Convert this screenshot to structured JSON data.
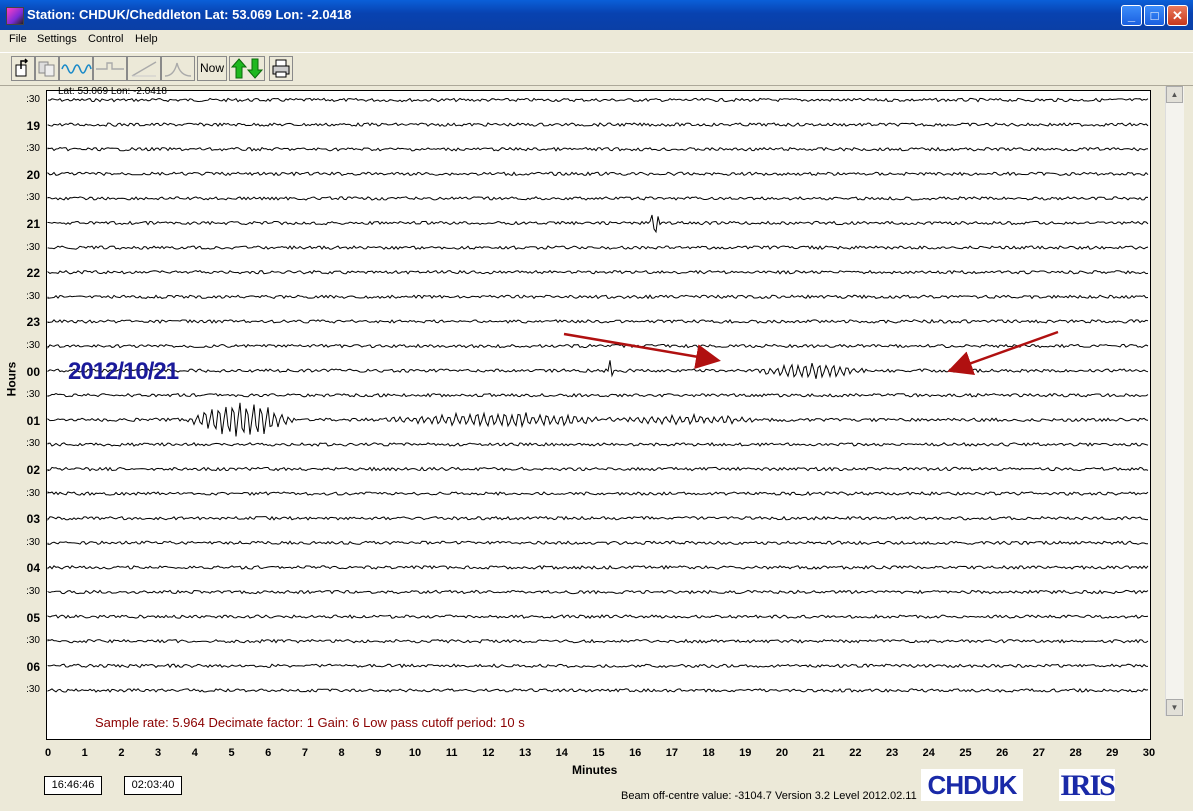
{
  "window": {
    "title": "Station: CHDUK/Cheddleton Lat: 53.069 Lon: -2.0418",
    "controls": {
      "minimize": "_",
      "maximize": "□",
      "close": "✕"
    }
  },
  "menu": [
    "File",
    "Settings",
    "Control",
    "Help"
  ],
  "toolbar": {
    "tools": [
      {
        "name": "open-icon"
      },
      {
        "name": "copy-icon"
      },
      {
        "name": "waveform-icon"
      },
      {
        "name": "filter-step-icon"
      },
      {
        "name": "ramp-icon"
      },
      {
        "name": "pulse-icon"
      }
    ],
    "now_label": "Now",
    "updown_icon": "green-up-down-arrows-icon",
    "print_icon": "printer-icon"
  },
  "plot": {
    "coordinates": "Lat: 53.069 Lon: -2.0418",
    "date": "2012/10/21",
    "y_axis_title": "Hours",
    "x_axis_title": "Minutes",
    "row_labels": [
      ":30",
      "19",
      ":30",
      "20",
      ":30",
      "21",
      ":30",
      "22",
      ":30",
      "23",
      ":30",
      "00",
      ":30",
      "01",
      ":30",
      "02",
      ":30",
      "03",
      ":30",
      "04",
      ":30",
      "05",
      ":30",
      "06",
      ":30"
    ],
    "minute_ticks": [
      "0",
      "1",
      "2",
      "3",
      "4",
      "5",
      "6",
      "7",
      "8",
      "9",
      "10",
      "11",
      "12",
      "13",
      "14",
      "15",
      "16",
      "17",
      "18",
      "19",
      "20",
      "21",
      "22",
      "23",
      "24",
      "25",
      "26",
      "27",
      "28",
      "29",
      "30"
    ],
    "info": "Sample rate: 5.964  Decimate factor: 1  Gain: 6  Low pass cutoff period: 10 s"
  },
  "status": {
    "time_local": "16:46:46",
    "time_elapsed": "02:03:40",
    "beam": "Beam off-centre value: -3104.7",
    "version": "Version 3.2 Level 2012.02.11"
  },
  "logos": {
    "station": "CHDUK",
    "iris": "IRIS"
  },
  "colors": {
    "date": "#1a1a9a",
    "info": "#8b0000",
    "arrows": "#b01010"
  }
}
